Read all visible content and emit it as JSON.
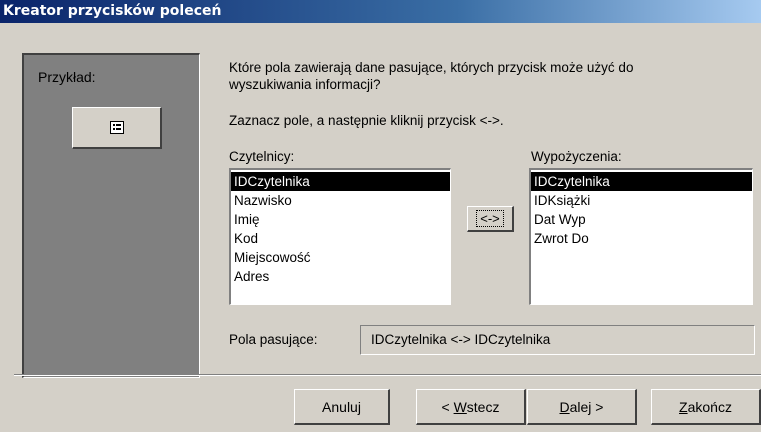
{
  "window": {
    "title": "Kreator przycisków poleceń"
  },
  "example": {
    "label": "Przykład:",
    "icon": "form-icon"
  },
  "instructions": {
    "line1": "Które pola zawierają  dane pasujące, których przycisk może użyć do",
    "line2": "wyszukiwania informacji?",
    "line3": "Zaznacz pole, a następnie kliknij przycisk <->."
  },
  "left_list": {
    "label": "Czytelnicy:",
    "items": [
      "IDCzytelnika",
      "Nazwisko",
      "Imię",
      "Kod",
      "Miejscowość",
      "Adres"
    ],
    "selected_index": 0
  },
  "right_list": {
    "label": "Wypożyczenia:",
    "items": [
      "IDCzytelnika",
      "IDKsiążki",
      "Dat Wyp",
      "Zwrot Do"
    ],
    "selected_index": 0
  },
  "swap_button": {
    "label": "<->"
  },
  "matching": {
    "label": "Pola pasujące:",
    "value": "IDCzytelnika <-> IDCzytelnika"
  },
  "buttons": {
    "cancel": "Anuluj",
    "back_prefix": "< ",
    "back_mnemonic": "W",
    "back_rest": "stecz",
    "next_mnemonic": "D",
    "next_rest": "alej >",
    "finish_mnemonic": "Z",
    "finish_rest": "akończ"
  }
}
